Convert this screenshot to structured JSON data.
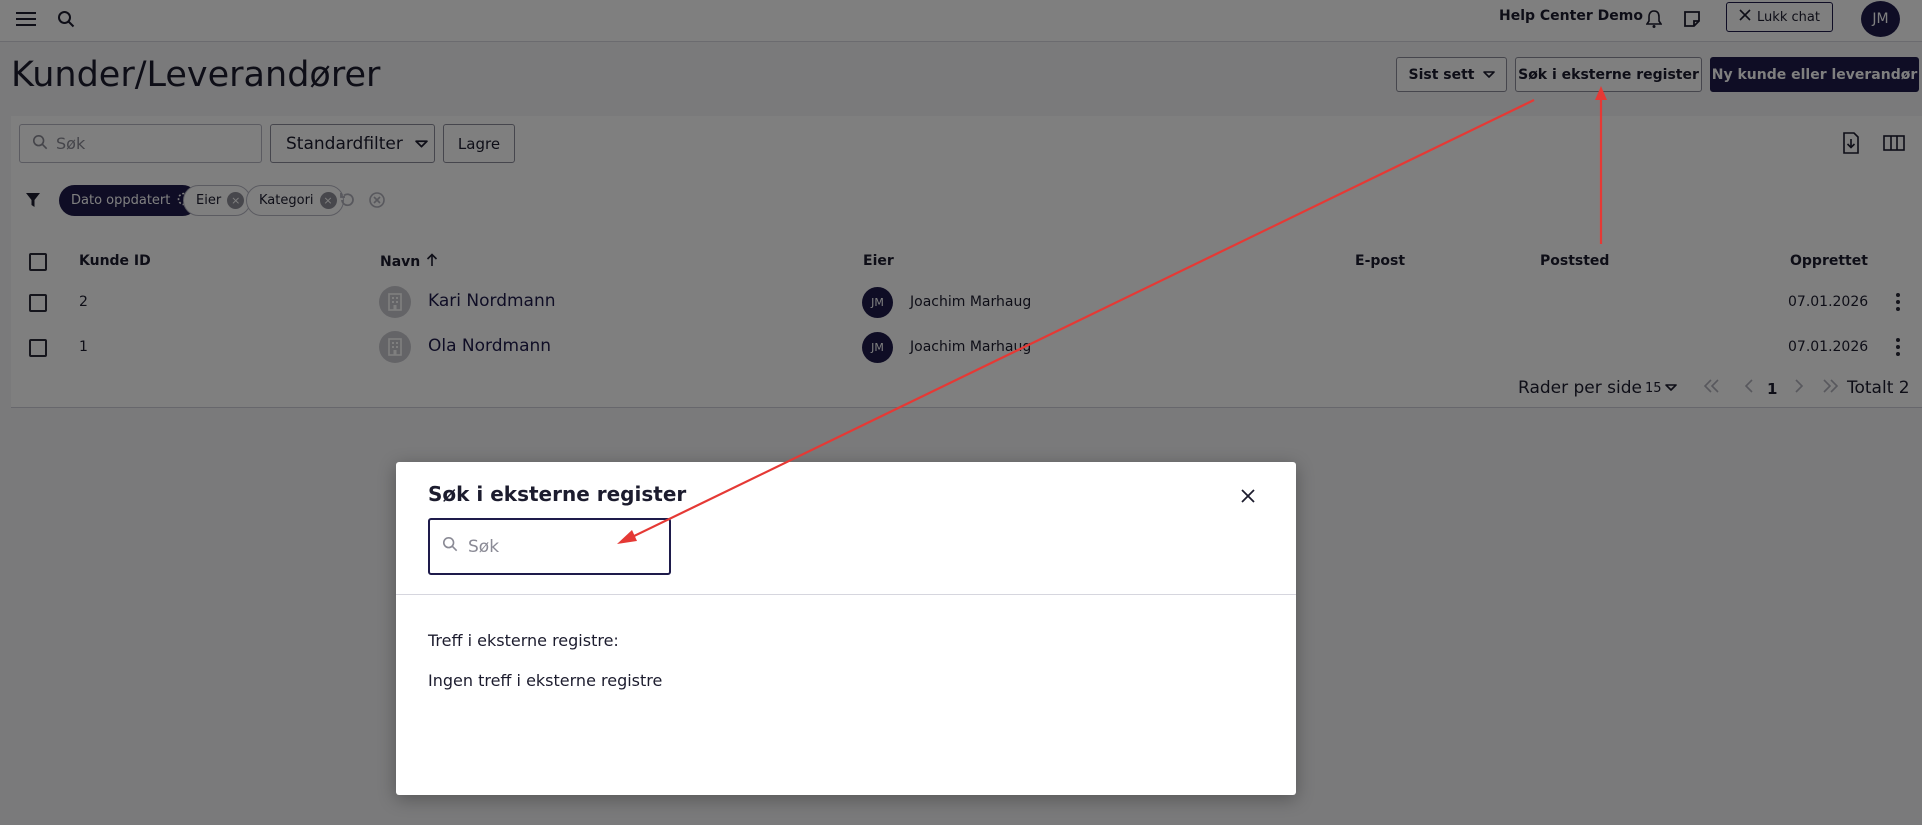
{
  "topbar": {
    "title": "Help Center Demo",
    "close_chat_label": "Lukk chat",
    "avatar_initials": "JM",
    "icons": [
      "menu-icon",
      "search-icon",
      "bell-icon",
      "sticky-note-icon"
    ]
  },
  "header": {
    "page_title": "Kunder/Leverandører",
    "recent_label": "Sist sett",
    "external_search_label": "Søk i eksterne register",
    "new_label": "Ny kunde eller leverandør"
  },
  "toolbar": {
    "search_placeholder": "Søk",
    "filter_label": "Standardfilter",
    "save_label": "Lagre",
    "icons": [
      "export-icon",
      "columns-icon"
    ]
  },
  "filters": {
    "chips": [
      {
        "label": "Dato oppdatert",
        "active": true
      },
      {
        "label": "Eier",
        "active": false
      },
      {
        "label": "Kategori",
        "active": false
      }
    ],
    "icons": [
      "filter-icon",
      "reset-icon",
      "clear-icon"
    ]
  },
  "table": {
    "columns": [
      "Kunde ID",
      "Navn",
      "Eier",
      "E-post",
      "Poststed",
      "Opprettet"
    ],
    "sort_column": "Navn",
    "rows": [
      {
        "id": "2",
        "name": "Kari Nordmann",
        "owner_initials": "JM",
        "owner": "Joachim Marhaug",
        "email": "",
        "city": "",
        "created": "07.01.2026"
      },
      {
        "id": "1",
        "name": "Ola Nordmann",
        "owner_initials": "JM",
        "owner": "Joachim Marhaug",
        "email": "",
        "city": "",
        "created": "07.01.2026"
      }
    ]
  },
  "pagination": {
    "rows_per_page_label": "Rader per side",
    "rows_per_page": "15",
    "current_page": "1",
    "total_label": "Totalt 2"
  },
  "modal": {
    "title": "Søk i eksterne register",
    "search_placeholder": "Søk",
    "results_heading": "Treff i eksterne registre:",
    "no_results": "Ingen treff i eksterne registre"
  },
  "colors": {
    "brand": "#1e1b4b",
    "annotation_arrow": "#e53935",
    "overlay": "rgba(0,0,0,0.5)"
  }
}
